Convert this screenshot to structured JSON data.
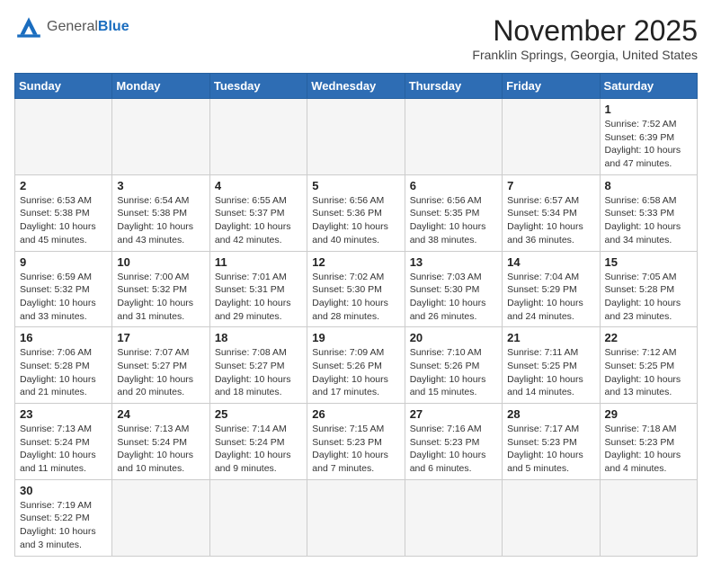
{
  "header": {
    "logo_general": "General",
    "logo_blue": "Blue",
    "month_title": "November 2025",
    "location": "Franklin Springs, Georgia, United States"
  },
  "weekdays": [
    "Sunday",
    "Monday",
    "Tuesday",
    "Wednesday",
    "Thursday",
    "Friday",
    "Saturday"
  ],
  "weeks": [
    [
      {
        "day": "",
        "info": ""
      },
      {
        "day": "",
        "info": ""
      },
      {
        "day": "",
        "info": ""
      },
      {
        "day": "",
        "info": ""
      },
      {
        "day": "",
        "info": ""
      },
      {
        "day": "",
        "info": ""
      },
      {
        "day": "1",
        "info": "Sunrise: 7:52 AM\nSunset: 6:39 PM\nDaylight: 10 hours\nand 47 minutes."
      }
    ],
    [
      {
        "day": "2",
        "info": "Sunrise: 6:53 AM\nSunset: 5:38 PM\nDaylight: 10 hours\nand 45 minutes."
      },
      {
        "day": "3",
        "info": "Sunrise: 6:54 AM\nSunset: 5:38 PM\nDaylight: 10 hours\nand 43 minutes."
      },
      {
        "day": "4",
        "info": "Sunrise: 6:55 AM\nSunset: 5:37 PM\nDaylight: 10 hours\nand 42 minutes."
      },
      {
        "day": "5",
        "info": "Sunrise: 6:56 AM\nSunset: 5:36 PM\nDaylight: 10 hours\nand 40 minutes."
      },
      {
        "day": "6",
        "info": "Sunrise: 6:56 AM\nSunset: 5:35 PM\nDaylight: 10 hours\nand 38 minutes."
      },
      {
        "day": "7",
        "info": "Sunrise: 6:57 AM\nSunset: 5:34 PM\nDaylight: 10 hours\nand 36 minutes."
      },
      {
        "day": "8",
        "info": "Sunrise: 6:58 AM\nSunset: 5:33 PM\nDaylight: 10 hours\nand 34 minutes."
      }
    ],
    [
      {
        "day": "9",
        "info": "Sunrise: 6:59 AM\nSunset: 5:32 PM\nDaylight: 10 hours\nand 33 minutes."
      },
      {
        "day": "10",
        "info": "Sunrise: 7:00 AM\nSunset: 5:32 PM\nDaylight: 10 hours\nand 31 minutes."
      },
      {
        "day": "11",
        "info": "Sunrise: 7:01 AM\nSunset: 5:31 PM\nDaylight: 10 hours\nand 29 minutes."
      },
      {
        "day": "12",
        "info": "Sunrise: 7:02 AM\nSunset: 5:30 PM\nDaylight: 10 hours\nand 28 minutes."
      },
      {
        "day": "13",
        "info": "Sunrise: 7:03 AM\nSunset: 5:30 PM\nDaylight: 10 hours\nand 26 minutes."
      },
      {
        "day": "14",
        "info": "Sunrise: 7:04 AM\nSunset: 5:29 PM\nDaylight: 10 hours\nand 24 minutes."
      },
      {
        "day": "15",
        "info": "Sunrise: 7:05 AM\nSunset: 5:28 PM\nDaylight: 10 hours\nand 23 minutes."
      }
    ],
    [
      {
        "day": "16",
        "info": "Sunrise: 7:06 AM\nSunset: 5:28 PM\nDaylight: 10 hours\nand 21 minutes."
      },
      {
        "day": "17",
        "info": "Sunrise: 7:07 AM\nSunset: 5:27 PM\nDaylight: 10 hours\nand 20 minutes."
      },
      {
        "day": "18",
        "info": "Sunrise: 7:08 AM\nSunset: 5:27 PM\nDaylight: 10 hours\nand 18 minutes."
      },
      {
        "day": "19",
        "info": "Sunrise: 7:09 AM\nSunset: 5:26 PM\nDaylight: 10 hours\nand 17 minutes."
      },
      {
        "day": "20",
        "info": "Sunrise: 7:10 AM\nSunset: 5:26 PM\nDaylight: 10 hours\nand 15 minutes."
      },
      {
        "day": "21",
        "info": "Sunrise: 7:11 AM\nSunset: 5:25 PM\nDaylight: 10 hours\nand 14 minutes."
      },
      {
        "day": "22",
        "info": "Sunrise: 7:12 AM\nSunset: 5:25 PM\nDaylight: 10 hours\nand 13 minutes."
      }
    ],
    [
      {
        "day": "23",
        "info": "Sunrise: 7:13 AM\nSunset: 5:24 PM\nDaylight: 10 hours\nand 11 minutes."
      },
      {
        "day": "24",
        "info": "Sunrise: 7:13 AM\nSunset: 5:24 PM\nDaylight: 10 hours\nand 10 minutes."
      },
      {
        "day": "25",
        "info": "Sunrise: 7:14 AM\nSunset: 5:24 PM\nDaylight: 10 hours\nand 9 minutes."
      },
      {
        "day": "26",
        "info": "Sunrise: 7:15 AM\nSunset: 5:23 PM\nDaylight: 10 hours\nand 7 minutes."
      },
      {
        "day": "27",
        "info": "Sunrise: 7:16 AM\nSunset: 5:23 PM\nDaylight: 10 hours\nand 6 minutes."
      },
      {
        "day": "28",
        "info": "Sunrise: 7:17 AM\nSunset: 5:23 PM\nDaylight: 10 hours\nand 5 minutes."
      },
      {
        "day": "29",
        "info": "Sunrise: 7:18 AM\nSunset: 5:23 PM\nDaylight: 10 hours\nand 4 minutes."
      }
    ],
    [
      {
        "day": "30",
        "info": "Sunrise: 7:19 AM\nSunset: 5:22 PM\nDaylight: 10 hours\nand 3 minutes."
      },
      {
        "day": "",
        "info": ""
      },
      {
        "day": "",
        "info": ""
      },
      {
        "day": "",
        "info": ""
      },
      {
        "day": "",
        "info": ""
      },
      {
        "day": "",
        "info": ""
      },
      {
        "day": "",
        "info": ""
      }
    ]
  ]
}
